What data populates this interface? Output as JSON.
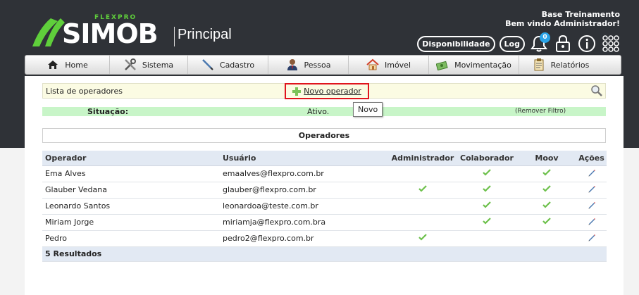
{
  "header": {
    "logo_brand": "FLEXPRO",
    "logo_name": "SIMOB",
    "section": "Principal",
    "company": "Base Treinamento",
    "welcome": "Bem vindo Administrador!",
    "buttons": {
      "availability": "Disponibilidade",
      "log": "Log"
    },
    "notification_count": "0"
  },
  "nav": {
    "items": [
      {
        "label": "Home",
        "icon": "home-icon"
      },
      {
        "label": "Sistema",
        "icon": "tools-icon"
      },
      {
        "label": "Cadastro",
        "icon": "pen-icon"
      },
      {
        "label": "Pessoa",
        "icon": "person-icon"
      },
      {
        "label": "Imóvel",
        "icon": "house-icon"
      },
      {
        "label": "Movimentação",
        "icon": "money-icon"
      },
      {
        "label": "Relatórios",
        "icon": "clipboard-icon"
      }
    ]
  },
  "list": {
    "label": "Lista de operadores",
    "new_label": "Novo operador",
    "tooltip": "Novo"
  },
  "filter": {
    "label": "Situação:",
    "value": "Ativo.",
    "remove": "(Remover Filtro)"
  },
  "section_title": "Operadores",
  "table": {
    "columns": [
      "Operador",
      "Usuário",
      "Administrador",
      "Colaborador",
      "Moov",
      "Ações"
    ],
    "rows": [
      {
        "operador": "Ema Alves",
        "usuario": "emaalves@flexpro.com.br",
        "admin": false,
        "colab": true,
        "moov": true
      },
      {
        "operador": "Glauber Vedana",
        "usuario": "glauber@flexpro.com.br",
        "admin": true,
        "colab": true,
        "moov": true
      },
      {
        "operador": "Leonardo Santos",
        "usuario": "leonardoa@teste.com.br",
        "admin": false,
        "colab": true,
        "moov": true
      },
      {
        "operador": "Miriam Jorge",
        "usuario": "miriamja@flexpro.com.bra",
        "admin": false,
        "colab": true,
        "moov": true
      },
      {
        "operador": "Pedro",
        "usuario": "pedro2@flexpro.com.br",
        "admin": true,
        "colab": false,
        "moov": false
      }
    ],
    "footer": "5 Resultados"
  },
  "colors": {
    "header_bg": "#2f3237",
    "brand_green": "#5fcf3b",
    "check_green": "#6cc04a",
    "highlight_red": "#e0141e"
  }
}
